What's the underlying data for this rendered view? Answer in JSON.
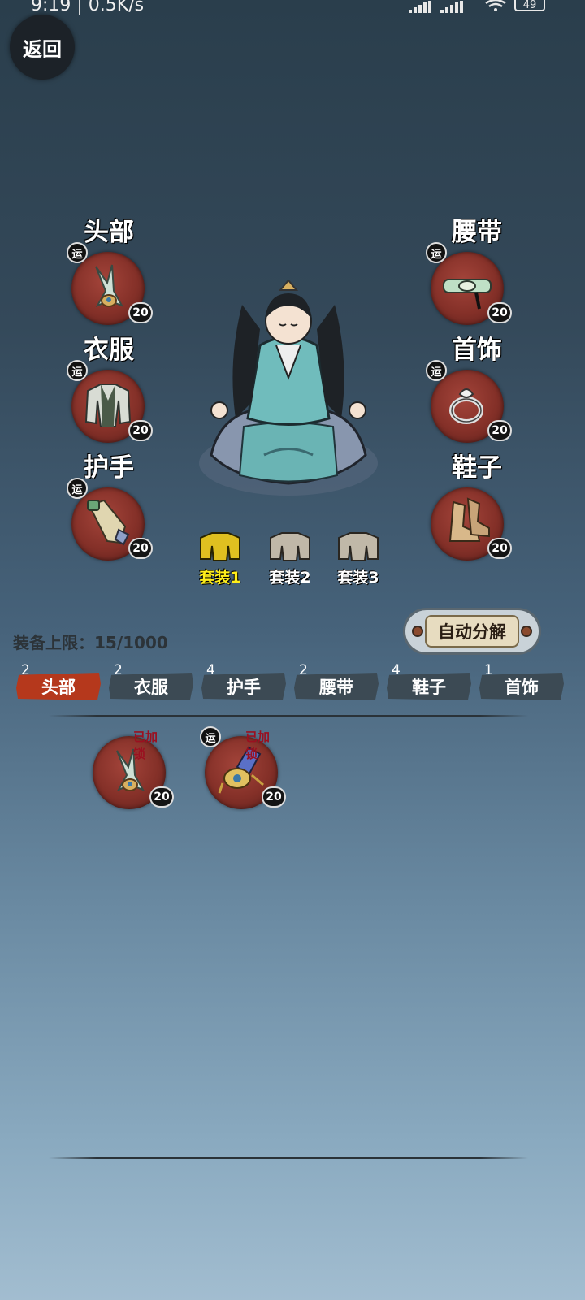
{
  "status_bar": {
    "time": "9:19 | 0.5K/s",
    "battery": "49"
  },
  "back_button": "返回",
  "slots": [
    {
      "label": "头部",
      "yun": "运",
      "level": "20"
    },
    {
      "label": "衣服",
      "yun": "运",
      "level": "20"
    },
    {
      "label": "护手",
      "yun": "运",
      "level": "20"
    },
    {
      "label": "腰带",
      "yun": "运",
      "level": "20"
    },
    {
      "label": "首饰",
      "yun": "运",
      "level": "20"
    },
    {
      "label": "鞋子",
      "yun": "",
      "level": "20"
    }
  ],
  "suits": [
    {
      "label": "套装1",
      "active": true
    },
    {
      "label": "套装2",
      "active": false
    },
    {
      "label": "套装3",
      "active": false
    }
  ],
  "equipment_limit": "装备上限：15/1000",
  "auto_decompose": "自动分解",
  "tabs": [
    {
      "label": "头部",
      "count": "2",
      "active": true
    },
    {
      "label": "衣服",
      "count": "2",
      "active": false
    },
    {
      "label": "护手",
      "count": "4",
      "active": false
    },
    {
      "label": "腰带",
      "count": "2",
      "active": false
    },
    {
      "label": "鞋子",
      "count": "4",
      "active": false
    },
    {
      "label": "首饰",
      "count": "1",
      "active": false
    }
  ],
  "inventory": [
    {
      "locked": "已加锁",
      "yun": "",
      "level": "20"
    },
    {
      "locked": "已加锁",
      "yun": "运",
      "level": "20"
    }
  ],
  "colors": {
    "slot_red": "#843028",
    "active_tab": "#b5381c",
    "suit_active_text": "#ffee1a",
    "locked_text": "#9a1020"
  }
}
